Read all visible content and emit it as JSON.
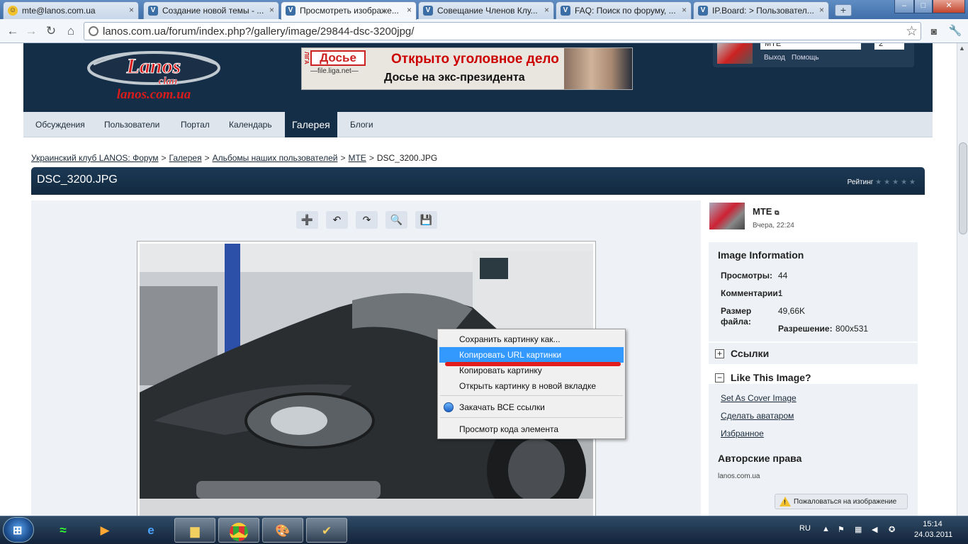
{
  "browser": {
    "tabs": [
      {
        "label": "mte@lanos.com.ua",
        "icon": "mail-icon"
      },
      {
        "label": "Создание новой темы - ...",
        "icon": "forum-icon"
      },
      {
        "label": "Просмотреть изображе...",
        "icon": "forum-icon",
        "active": true
      },
      {
        "label": "Совещание Членов Клу...",
        "icon": "forum-icon"
      },
      {
        "label": "FAQ: Поиск по форуму, ...",
        "icon": "forum-icon"
      },
      {
        "label": "IP.Board: > Пользовател...",
        "icon": "forum-icon"
      }
    ],
    "new_tab": "+",
    "window_buttons": {
      "minimize": "–",
      "maximize": "□",
      "close": "✕"
    },
    "url": "lanos.com.ua/forum/index.php?/gallery/image/29844-dsc-3200jpg/"
  },
  "site": {
    "logo_text": {
      "top": "Lanos",
      "middle": "clan",
      "bottom": "lanos.com.ua"
    },
    "banner": {
      "brand": "Досье",
      "brand_side": "ЛІГА",
      "site": "—file.liga.net—",
      "headline": "Открыто уголовное дело",
      "subline": "Досье на экс-президента"
    },
    "user": {
      "name": "MTE",
      "count": "2",
      "logout": "Выход",
      "help": "Помощь"
    },
    "nav": [
      {
        "label": "Обсуждения"
      },
      {
        "label": "Пользователи"
      },
      {
        "label": "Портал"
      },
      {
        "label": "Календарь"
      },
      {
        "label": "Галерея",
        "active": true
      },
      {
        "label": "Блоги"
      }
    ],
    "breadcrumbs": [
      "Украинский клуб LANOS: Форум",
      "Галерея",
      "Альбомы наших пользователей",
      "MTE",
      "DSC_3200.JPG"
    ],
    "image_title": "DSC_3200.JPG",
    "rating_label": "Рейтинг",
    "rating_stars": "★★★★★"
  },
  "sidebar": {
    "author": {
      "name": "MTE",
      "date": "Вчера, 22:24"
    },
    "info_title": "Image Information",
    "views_label": "Просмотры:",
    "views_value": "44",
    "comments_label": "Комментарии:",
    "comments_value": "1",
    "size_label": "Размер файла:",
    "size_value": "49,66K",
    "resolution_label": "Разрешение:",
    "resolution_value": "800x531",
    "links_title": "Ссылки",
    "like_title": "Like This Image?",
    "set_cover": "Set As Cover Image",
    "make_avatar": "Сделать аватаром",
    "favorites": "Избранное",
    "copyright_title": "Авторские права",
    "copyright_value": "lanos.com.ua",
    "report": "Пожаловаться на изображение"
  },
  "context_menu": {
    "items": [
      "Сохранить картинку как...",
      "Копировать URL картинки",
      "Копировать картинку",
      "Открыть картинку в новой вкладке",
      "Закачать ВСЕ ссылки",
      "Просмотр кода элемента"
    ],
    "highlighted_index": 1
  },
  "taskbar": {
    "language": "RU",
    "time": "15:14",
    "date": "24.03.2011"
  },
  "colors": {
    "site_dark": "#142e47",
    "menu_highlight": "#3399ff",
    "annotation_red": "#e21d1d"
  }
}
